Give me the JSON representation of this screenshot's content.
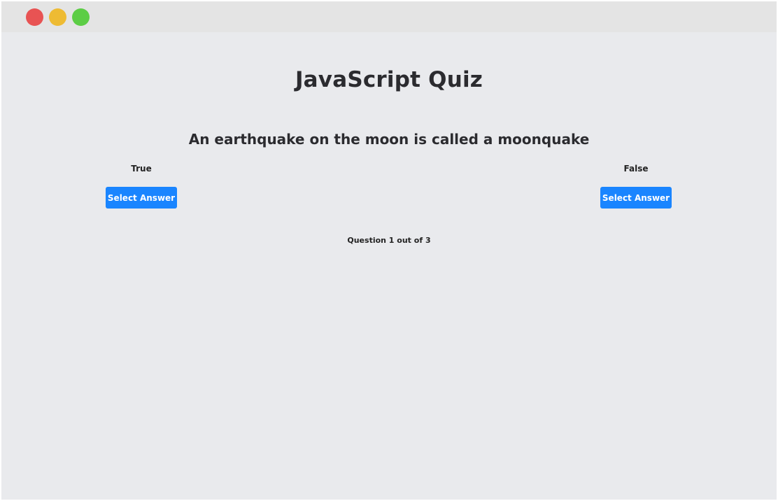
{
  "window": {
    "controls": {
      "close_color": "#e85353",
      "minimize_color": "#eebb33",
      "maximize_color": "#5ccd45"
    }
  },
  "quiz": {
    "title": "JavaScript Quiz",
    "question": "An earthquake on the moon is called a moonquake",
    "options": [
      {
        "label": "True",
        "button_label": "Select Answer"
      },
      {
        "label": "False",
        "button_label": "Select Answer"
      }
    ],
    "progress_text": "Question 1 out of 3"
  },
  "colors": {
    "accent": "#1a85ff",
    "background": "#e9eaed",
    "titlebar": "#e4e4e4",
    "text": "#2b2b2f"
  }
}
